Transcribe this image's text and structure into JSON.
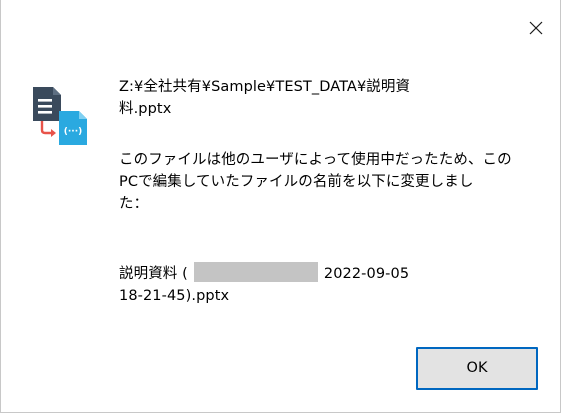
{
  "dialog": {
    "close_symbol": "✕",
    "icon": "file-conflict-sync-icon",
    "path_lines": [
      "Z:¥全社共有¥Sample¥TEST_DATA¥説明資",
      "料.pptx"
    ],
    "message_lines": [
      "このファイルは他のユーザによって使用中だったため、この",
      "PCで編集していたファイルの名前を以下に変更しまし",
      "た："
    ],
    "new_name_prefix": "説明資料 (",
    "new_name_date": "2022-09-05",
    "new_name_line2": "18-21-45).pptx",
    "ok_label": "OK"
  },
  "colors": {
    "icon_dark": "#3a4a5c",
    "icon_blue": "#2aa9e0",
    "icon_arrow": "#e8534a",
    "ok_border": "#0067c0",
    "ok_background": "#e3e3e3",
    "redaction": "#c4c4c4"
  }
}
